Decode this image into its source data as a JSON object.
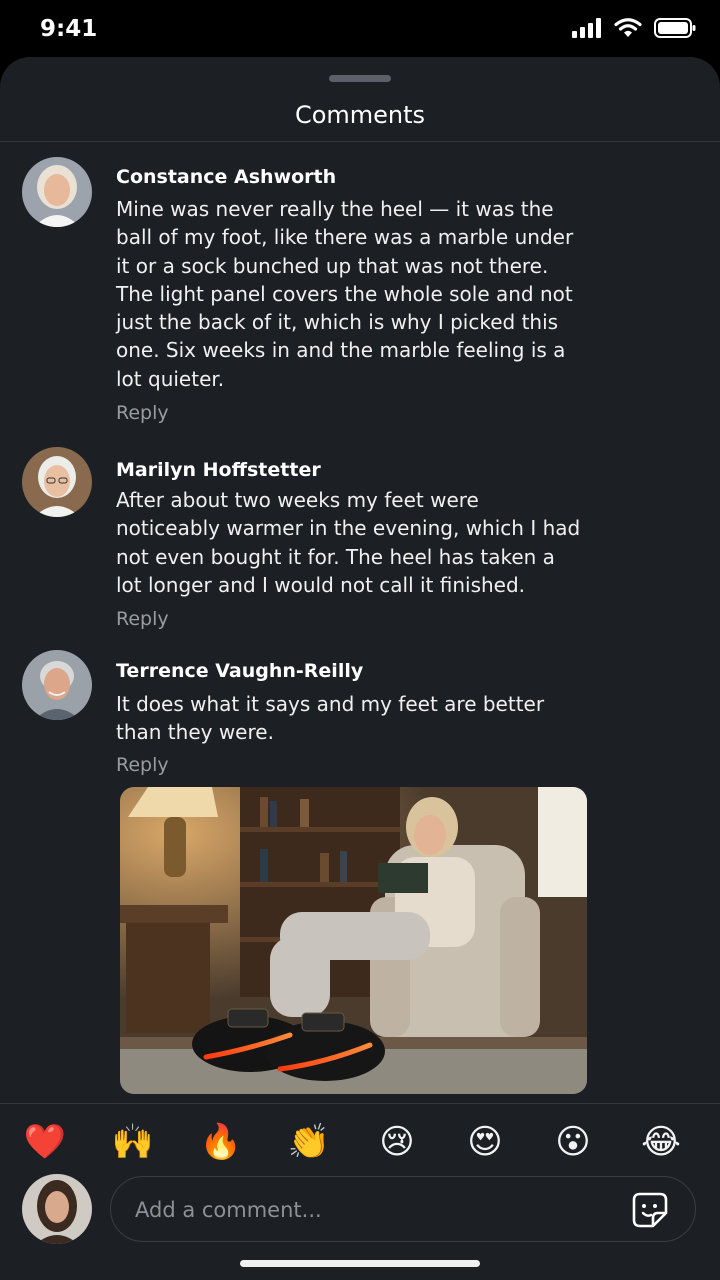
{
  "status_bar": {
    "time": "9:41"
  },
  "sheet": {
    "title": "Comments"
  },
  "comments": [
    {
      "author": "Constance Ashworth",
      "text": "Mine was never really the heel — it was the ball of my foot, like there was a marble under it or a sock bunched up that was not there. The light panel covers the whole sole and not just the back of it, which is why I picked this one. Six weeks in and the marble feeling is a lot quieter.",
      "reply_label": "Reply"
    },
    {
      "author": "Marilyn Hoffstetter",
      "text": "After about two weeks my feet were noticeably warmer in the evening, which I had not even bought it for. The heel has taken a lot longer and I would not call it finished.",
      "reply_label": "Reply"
    },
    {
      "author": "Terrence Vaughn-Reilly",
      "text": "It does what it says and my feet are better than they were.",
      "reply_label": "Reply",
      "has_photo": true
    }
  ],
  "reactions": [
    {
      "icon": "heart-icon",
      "glyph": "❤️"
    },
    {
      "icon": "raising-hands-icon",
      "glyph": "🙌"
    },
    {
      "icon": "fire-icon",
      "glyph": "🔥"
    },
    {
      "icon": "clapping-hands-icon",
      "glyph": "👏"
    },
    {
      "icon": "crying-face-icon",
      "glyph": "😢"
    },
    {
      "icon": "heart-eyes-icon",
      "glyph": "😍"
    },
    {
      "icon": "surprised-face-icon",
      "glyph": "😮"
    },
    {
      "icon": "laughing-face-icon",
      "glyph": "😂"
    }
  ],
  "composer": {
    "placeholder": "Add a comment...",
    "sticker_icon": "sticker-icon"
  },
  "colors": {
    "sheet_bg": "#1c1f24",
    "text": "#f0f0f0",
    "muted": "#9a9ca1",
    "glow": "#ff5a1f"
  }
}
